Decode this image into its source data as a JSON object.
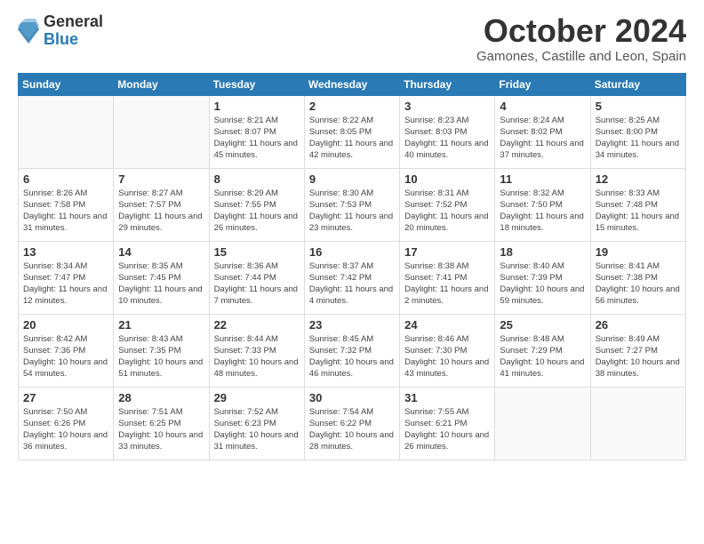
{
  "header": {
    "logo_general": "General",
    "logo_blue": "Blue",
    "month_title": "October 2024",
    "subtitle": "Gamones, Castille and Leon, Spain"
  },
  "days_of_week": [
    "Sunday",
    "Monday",
    "Tuesday",
    "Wednesday",
    "Thursday",
    "Friday",
    "Saturday"
  ],
  "weeks": [
    [
      {
        "day": "",
        "info": ""
      },
      {
        "day": "",
        "info": ""
      },
      {
        "day": "1",
        "info": "Sunrise: 8:21 AM\nSunset: 8:07 PM\nDaylight: 11 hours and 45 minutes."
      },
      {
        "day": "2",
        "info": "Sunrise: 8:22 AM\nSunset: 8:05 PM\nDaylight: 11 hours and 42 minutes."
      },
      {
        "day": "3",
        "info": "Sunrise: 8:23 AM\nSunset: 8:03 PM\nDaylight: 11 hours and 40 minutes."
      },
      {
        "day": "4",
        "info": "Sunrise: 8:24 AM\nSunset: 8:02 PM\nDaylight: 11 hours and 37 minutes."
      },
      {
        "day": "5",
        "info": "Sunrise: 8:25 AM\nSunset: 8:00 PM\nDaylight: 11 hours and 34 minutes."
      }
    ],
    [
      {
        "day": "6",
        "info": "Sunrise: 8:26 AM\nSunset: 7:58 PM\nDaylight: 11 hours and 31 minutes."
      },
      {
        "day": "7",
        "info": "Sunrise: 8:27 AM\nSunset: 7:57 PM\nDaylight: 11 hours and 29 minutes."
      },
      {
        "day": "8",
        "info": "Sunrise: 8:29 AM\nSunset: 7:55 PM\nDaylight: 11 hours and 26 minutes."
      },
      {
        "day": "9",
        "info": "Sunrise: 8:30 AM\nSunset: 7:53 PM\nDaylight: 11 hours and 23 minutes."
      },
      {
        "day": "10",
        "info": "Sunrise: 8:31 AM\nSunset: 7:52 PM\nDaylight: 11 hours and 20 minutes."
      },
      {
        "day": "11",
        "info": "Sunrise: 8:32 AM\nSunset: 7:50 PM\nDaylight: 11 hours and 18 minutes."
      },
      {
        "day": "12",
        "info": "Sunrise: 8:33 AM\nSunset: 7:48 PM\nDaylight: 11 hours and 15 minutes."
      }
    ],
    [
      {
        "day": "13",
        "info": "Sunrise: 8:34 AM\nSunset: 7:47 PM\nDaylight: 11 hours and 12 minutes."
      },
      {
        "day": "14",
        "info": "Sunrise: 8:35 AM\nSunset: 7:45 PM\nDaylight: 11 hours and 10 minutes."
      },
      {
        "day": "15",
        "info": "Sunrise: 8:36 AM\nSunset: 7:44 PM\nDaylight: 11 hours and 7 minutes."
      },
      {
        "day": "16",
        "info": "Sunrise: 8:37 AM\nSunset: 7:42 PM\nDaylight: 11 hours and 4 minutes."
      },
      {
        "day": "17",
        "info": "Sunrise: 8:38 AM\nSunset: 7:41 PM\nDaylight: 11 hours and 2 minutes."
      },
      {
        "day": "18",
        "info": "Sunrise: 8:40 AM\nSunset: 7:39 PM\nDaylight: 10 hours and 59 minutes."
      },
      {
        "day": "19",
        "info": "Sunrise: 8:41 AM\nSunset: 7:38 PM\nDaylight: 10 hours and 56 minutes."
      }
    ],
    [
      {
        "day": "20",
        "info": "Sunrise: 8:42 AM\nSunset: 7:36 PM\nDaylight: 10 hours and 54 minutes."
      },
      {
        "day": "21",
        "info": "Sunrise: 8:43 AM\nSunset: 7:35 PM\nDaylight: 10 hours and 51 minutes."
      },
      {
        "day": "22",
        "info": "Sunrise: 8:44 AM\nSunset: 7:33 PM\nDaylight: 10 hours and 48 minutes."
      },
      {
        "day": "23",
        "info": "Sunrise: 8:45 AM\nSunset: 7:32 PM\nDaylight: 10 hours and 46 minutes."
      },
      {
        "day": "24",
        "info": "Sunrise: 8:46 AM\nSunset: 7:30 PM\nDaylight: 10 hours and 43 minutes."
      },
      {
        "day": "25",
        "info": "Sunrise: 8:48 AM\nSunset: 7:29 PM\nDaylight: 10 hours and 41 minutes."
      },
      {
        "day": "26",
        "info": "Sunrise: 8:49 AM\nSunset: 7:27 PM\nDaylight: 10 hours and 38 minutes."
      }
    ],
    [
      {
        "day": "27",
        "info": "Sunrise: 7:50 AM\nSunset: 6:26 PM\nDaylight: 10 hours and 36 minutes."
      },
      {
        "day": "28",
        "info": "Sunrise: 7:51 AM\nSunset: 6:25 PM\nDaylight: 10 hours and 33 minutes."
      },
      {
        "day": "29",
        "info": "Sunrise: 7:52 AM\nSunset: 6:23 PM\nDaylight: 10 hours and 31 minutes."
      },
      {
        "day": "30",
        "info": "Sunrise: 7:54 AM\nSunset: 6:22 PM\nDaylight: 10 hours and 28 minutes."
      },
      {
        "day": "31",
        "info": "Sunrise: 7:55 AM\nSunset: 6:21 PM\nDaylight: 10 hours and 26 minutes."
      },
      {
        "day": "",
        "info": ""
      },
      {
        "day": "",
        "info": ""
      }
    ]
  ]
}
